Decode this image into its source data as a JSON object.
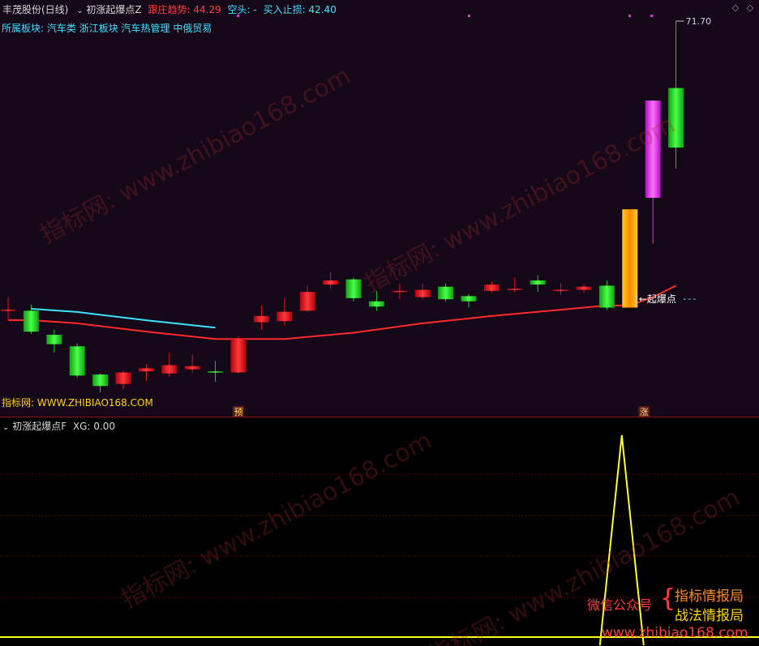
{
  "header": {
    "stock": "丰茂股份(日线)",
    "indicator": "初涨起爆点Z",
    "trend_label": "跟庄趋势:",
    "trend_value": "44.29",
    "short_label": "空头:",
    "short_value": "-",
    "stop_label": "买入止损:",
    "stop_value": "42.40"
  },
  "sector": {
    "label": "所属板块:",
    "items": "汽车类 浙江板块 汽车热管理 中俄贸易"
  },
  "site_line": {
    "label": "指标网:",
    "url": "WWW.ZHIBIAO168.COM"
  },
  "price_max_label": "71.70",
  "annotation_qbd": "起爆点",
  "markers": {
    "pre": "预",
    "up": "涨"
  },
  "sub_header": {
    "name": "初涨起爆点F",
    "xg_label": "XG:",
    "xg_value": "0.00"
  },
  "promo": {
    "prefix": "微信公众号",
    "line1": "指标情报局",
    "line2": "战法情报局",
    "url": "www.zhibiao168.com"
  },
  "watermark_text": "指标网: www.zhibiao168.com",
  "colors": {
    "up": "#e0101a",
    "down": "#18d018",
    "ma": "#ff2a2a",
    "cyan_line": "#3be3ff",
    "xg_line": "#ffff20",
    "magenta": "#e030e0",
    "orange": "#ff9a10"
  },
  "chart_data": {
    "type": "candlestick",
    "candles": [
      {
        "o": 44.1,
        "c": 44.1,
        "h": 45.3,
        "l": 43.1
      },
      {
        "o": 44.0,
        "c": 42.0,
        "h": 44.6,
        "l": 41.8
      },
      {
        "o": 41.7,
        "c": 40.8,
        "h": 42.2,
        "l": 40.0
      },
      {
        "o": 40.6,
        "c": 37.8,
        "h": 40.9,
        "l": 37.6
      },
      {
        "o": 37.9,
        "c": 36.8,
        "h": 38.0,
        "l": 36.2
      },
      {
        "o": 37.0,
        "c": 38.1,
        "h": 38.3,
        "l": 36.5
      },
      {
        "o": 38.2,
        "c": 38.5,
        "h": 38.9,
        "l": 37.3
      },
      {
        "o": 38.0,
        "c": 38.8,
        "h": 40.0,
        "l": 37.7
      },
      {
        "o": 38.4,
        "c": 38.7,
        "h": 39.8,
        "l": 38.1
      },
      {
        "o": 38.2,
        "c": 38.1,
        "h": 39.2,
        "l": 37.2
      },
      {
        "o": 38.1,
        "c": 41.3,
        "h": 41.6,
        "l": 38.0
      },
      {
        "o": 42.9,
        "c": 43.5,
        "h": 44.5,
        "l": 42.2
      },
      {
        "o": 43.0,
        "c": 43.9,
        "h": 45.2,
        "l": 42.6
      },
      {
        "o": 44.0,
        "c": 45.8,
        "h": 46.4,
        "l": 43.9
      },
      {
        "o": 46.5,
        "c": 46.9,
        "h": 47.7,
        "l": 46.1
      },
      {
        "o": 47.0,
        "c": 45.2,
        "h": 47.2,
        "l": 44.9
      },
      {
        "o": 44.9,
        "c": 44.4,
        "h": 45.9,
        "l": 44.0
      },
      {
        "o": 45.9,
        "c": 45.9,
        "h": 46.6,
        "l": 45.1
      },
      {
        "o": 45.3,
        "c": 46.0,
        "h": 46.6,
        "l": 45.1
      },
      {
        "o": 46.3,
        "c": 45.1,
        "h": 46.6,
        "l": 44.9
      },
      {
        "o": 45.4,
        "c": 44.9,
        "h": 45.6,
        "l": 44.3
      },
      {
        "o": 45.9,
        "c": 46.5,
        "h": 46.8,
        "l": 45.7
      },
      {
        "o": 46.1,
        "c": 46.1,
        "h": 47.2,
        "l": 45.8
      },
      {
        "o": 46.9,
        "c": 46.5,
        "h": 47.4,
        "l": 45.8
      },
      {
        "o": 46.0,
        "c": 46.0,
        "h": 46.6,
        "l": 45.5
      },
      {
        "o": 46.0,
        "c": 46.3,
        "h": 46.5,
        "l": 45.7
      },
      {
        "o": 46.4,
        "c": 44.3,
        "h": 46.9,
        "l": 44.1
      },
      {
        "o": 44.3,
        "c": 53.7,
        "h": 53.7,
        "l": 44.3
      },
      {
        "o": 54.8,
        "c": 64.1,
        "h": 64.1,
        "l": 50.4
      },
      {
        "o": 65.3,
        "c": 59.6,
        "h": 71.7,
        "l": 57.6
      }
    ],
    "special": {
      "27": "orange",
      "28": "magenta"
    },
    "ma": [
      {
        "i": 0,
        "v": 43.1
      },
      {
        "i": 1,
        "v": 43.1
      },
      {
        "i": 3,
        "v": 42.8
      },
      {
        "i": 6,
        "v": 42.0
      },
      {
        "i": 9,
        "v": 41.3
      },
      {
        "i": 10,
        "v": 41.3
      },
      {
        "i": 12,
        "v": 41.3
      },
      {
        "i": 15,
        "v": 41.9
      },
      {
        "i": 18,
        "v": 42.8
      },
      {
        "i": 21,
        "v": 43.5
      },
      {
        "i": 24,
        "v": 44.1
      },
      {
        "i": 26,
        "v": 44.5
      },
      {
        "i": 27,
        "v": 44.5
      },
      {
        "i": 28,
        "v": 45.3
      },
      {
        "i": 29,
        "v": 46.4
      }
    ],
    "cyan_range": [
      1,
      9
    ],
    "sub_series": {
      "peak_index": 27,
      "peak_value": 1,
      "base": 0
    }
  }
}
